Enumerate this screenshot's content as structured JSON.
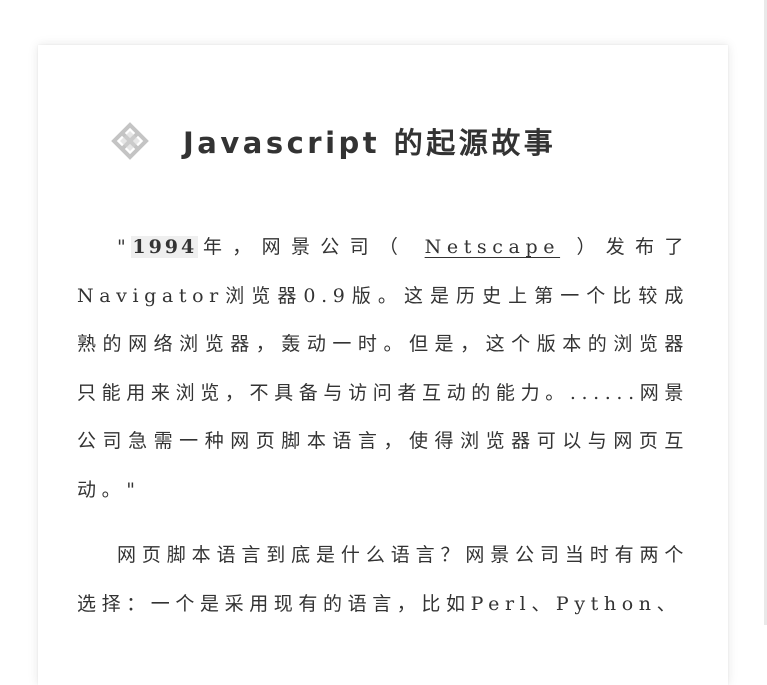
{
  "article": {
    "title": "Javascript 的起源故事",
    "logo_icon": "javascript-logo-icon",
    "paragraph1": {
      "quote_open": "\"",
      "year": "1994",
      "text_before_link": "年，网景公司（",
      "link": "Netscape",
      "text_after_link": "）发布了Navigator浏览器0.9版。这是历史上第一个比较成熟的网络浏览器，轰动一时。但是，这个版本的浏览器只能用来浏览，不具备与访问者互动的能力。......网景公司急需一种网页脚本语言，使得浏览器可以与网页互动。\""
    },
    "paragraph2": "网页脚本语言到底是什么语言？网景公司当时有两个选择：一个是采用现有的语言，比如Perl、Python、"
  },
  "colors": {
    "text": "#333333",
    "highlight_bg": "#efefef",
    "card_bg": "#ffffff"
  }
}
